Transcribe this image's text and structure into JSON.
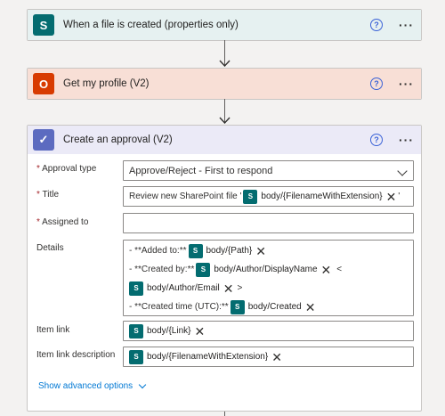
{
  "steps": [
    {
      "title": "When a file is created (properties only)",
      "icon": "sharepoint-icon",
      "icon_letter": "S"
    },
    {
      "title": "Get my profile (V2)",
      "icon": "office365-icon",
      "icon_letter": "O"
    },
    {
      "title": "Create an approval (V2)",
      "icon": "approval-icon",
      "icon_letter": "✓"
    }
  ],
  "help_glyph": "?",
  "more_glyph": "···",
  "approval": {
    "approval_type": {
      "label": "Approval type",
      "value": "Approve/Reject - First to respond"
    },
    "title": {
      "label": "Title",
      "prefix": "Review new SharePoint file '",
      "token": "body/{FilenameWithExtension}",
      "suffix": "'"
    },
    "assigned_to": {
      "label": "Assigned to",
      "value": ""
    },
    "details": {
      "label": "Details",
      "line1_text": "- **Added to:**",
      "line1_token": "body/{Path}",
      "line2_text": "- **Created by:**",
      "line2_token": "body/Author/DisplayName",
      "line2_after": "<",
      "line3_token": "body/Author/Email",
      "line3_after": ">",
      "line4_text": "- **Created time (UTC):**",
      "line4_token": "body/Created"
    },
    "item_link": {
      "label": "Item link",
      "token": "body/{Link}"
    },
    "item_link_description": {
      "label": "Item link description",
      "token": "body/{FilenameWithExtension}"
    },
    "show_advanced": "Show advanced options"
  },
  "required_marker": "*",
  "token_icon_letter": "S",
  "token_remove": "✕",
  "colors": {
    "sharepoint": "#036c70",
    "office": "#d83b01",
    "approvals": "#5c6bc0",
    "link": "#0078d4"
  }
}
